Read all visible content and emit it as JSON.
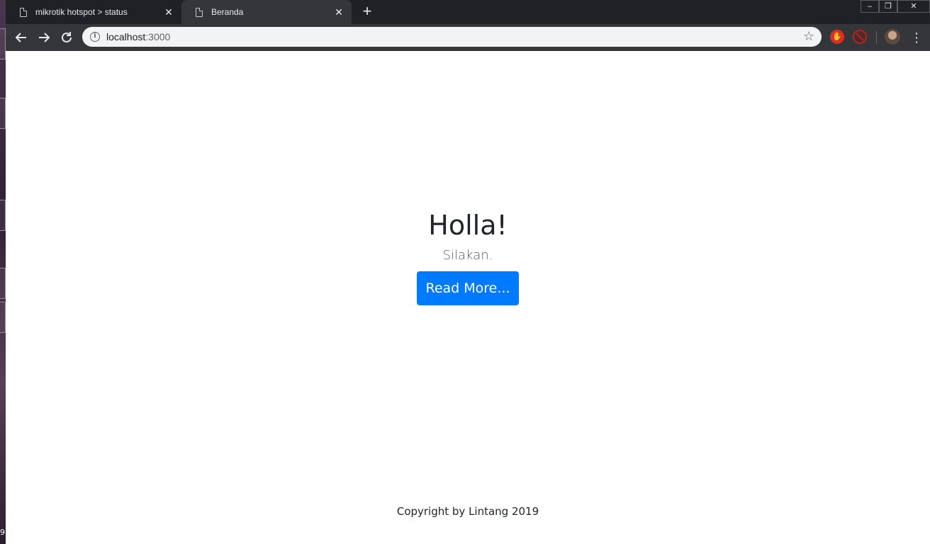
{
  "browser": {
    "tabs": [
      {
        "title": "mikrotik hotspot > status",
        "active": false
      },
      {
        "title": "Beranda",
        "active": true
      }
    ],
    "address": {
      "host": "localhost",
      "port": ":3000"
    },
    "window_controls": {
      "minimize": "–",
      "restore": "❐",
      "close": "✕"
    }
  },
  "page": {
    "heading": "Holla!",
    "lead": "Silakan.",
    "button_label": "Read More...",
    "footer": "Copyright by Lintang 2019"
  },
  "colors": {
    "primary": "#007bff",
    "chrome_dark": "#202124",
    "chrome_toolbar": "#35363a"
  },
  "desktop": {
    "edge_digit": "9"
  }
}
